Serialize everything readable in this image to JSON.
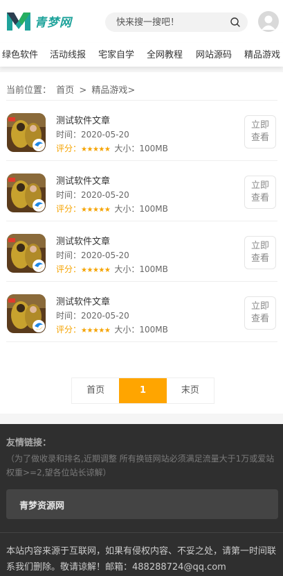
{
  "header": {
    "logo_text": "青梦网",
    "search_placeholder": "快来搜一搜吧！",
    "brand_color": "#1fa39b"
  },
  "nav": {
    "items": [
      "绿色软件",
      "活动线报",
      "宅家自学",
      "全网教程",
      "网站源码",
      "精品游戏"
    ]
  },
  "breadcrumb": {
    "label": "当前位置：",
    "home": "首页",
    "separator": ">",
    "current": "精品游戏>"
  },
  "list": {
    "items": [
      {
        "title": "测试软件文章",
        "time": "时间：2020-05-20",
        "rating_label": "评分：",
        "stars": "★★★★★",
        "size": "大小：100MB",
        "button": "立即查看"
      },
      {
        "title": "测试软件文章",
        "time": "时间：2020-05-20",
        "rating_label": "评分：",
        "stars": "★★★★★",
        "size": "大小：100MB",
        "button": "立即查看"
      },
      {
        "title": "测试软件文章",
        "time": "时间：2020-05-20",
        "rating_label": "评分：",
        "stars": "★★★★★",
        "size": "大小：100MB",
        "button": "立即查看"
      },
      {
        "title": "测试软件文章",
        "time": "时间：2020-05-20",
        "rating_label": "评分：",
        "stars": "★★★★★",
        "size": "大小：100MB",
        "button": "立即查看"
      }
    ]
  },
  "pagination": {
    "first": "首页",
    "current": "1",
    "last": "末页",
    "accent": "#ffa500"
  },
  "footer": {
    "links_title": "友情链接：",
    "links_note": "（为了做收录和排名,近期调整 所有换链网站必须满足流量大于1万或爱站权重>=2,望各位站长谅解）",
    "link_item": "青梦资源网",
    "notice": "本站内容来源于互联网，如果有侵权内容、不妥之处，请第一时间联系我们删除。敬请谅解！邮箱：488288724@qq.com"
  }
}
